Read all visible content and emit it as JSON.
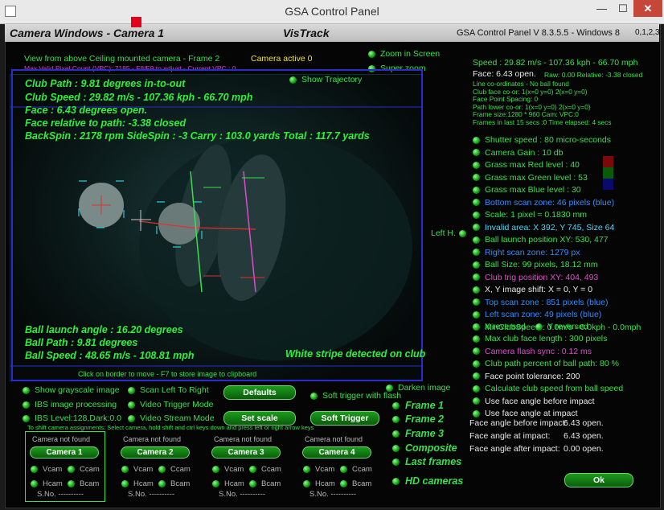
{
  "window": {
    "title": "GSA Control Panel",
    "min": "—",
    "max": "☐",
    "close": "✕"
  },
  "header": {
    "left": "Camera Windows - Camera  1",
    "center": "VisTrack",
    "version": "GSA Control Panel V 8.3.5.5 - Windows 8",
    "cams": "0,1,2,3"
  },
  "video": {
    "title": "View from above Ceiling mounted camera - Frame 2",
    "active": "Camera active 0",
    "vpc": "Max Valid Pixel Count (VPC): 7185 - F8/F9 to adjust - Current VPC : 0",
    "zoom_in": "Zoom in Screen",
    "super_zoom": "Super zoom",
    "show_traj": "Show Trajectory",
    "lines": [
      "Club Path : 9.81 degrees in-to-out",
      "Club Speed : 29.82 m/s - 107.36 kph - 66.70 mph",
      "Face : 6.43 degrees open.",
      "Face relative to path: -3.38 closed",
      "BackSpin : 2178 rpm  SideSpin : -3  Carry : 103.0 yards  Total : 117.7 yards"
    ],
    "bottom_lines": [
      "Ball launch angle : 16.20 degrees",
      "Ball Path : 9.81 degrees",
      "Ball Speed : 48.65 m/s - 108.81 mph"
    ],
    "stripe": "White stripe detected on club",
    "hint": "Click on border to move - F7 to store image to clipboard"
  },
  "right_info": {
    "speed": "Speed : 29.82 m/s - 107.36 kph - 66.70 mph",
    "face": "Face: 6.43 open.",
    "raw": "Raw: 0.00 Relative: -3.38 closed",
    "small": [
      "Line co-ordinates - No ball found",
      "Club face co-or: 1(x=0 y=0) 2(x=0 y=0)",
      "Face Point Spacing: 0",
      "Path lower co-or: 1(x=0 y=0) 2(x=0 y=0)",
      "Frame size:1280 * 960 Cam:  VPC:0",
      "Frames in last 15 secs :0 Time elapsed:   4 secs"
    ]
  },
  "settings": [
    {
      "label": "Shutter speed : 80 micro-seconds",
      "color": "#38e04b"
    },
    {
      "label": "Camera Gain : 10 db",
      "color": "#38e04b"
    },
    {
      "label": "Grass max Red level : 40",
      "color": "#38e04b"
    },
    {
      "label": "Grass max Green level : 53",
      "color": "#38e04b"
    },
    {
      "label": "Grass max Blue level : 30",
      "color": "#38e04b"
    },
    {
      "label": "Bottom scan zone: 46 pixels (blue)",
      "color": "#2f8cff"
    },
    {
      "label": "Scale: 1 pixel = 0.1830 mm",
      "color": "#38e04b"
    },
    {
      "label": "Invalid area: X 392, Y 745, Size 64",
      "color": "#4ad8ff"
    },
    {
      "label": "Ball launch position XY: 530, 477",
      "color": "#38e04b"
    },
    {
      "label": "Right scan zone: 1279 px",
      "color": "#2f8cff"
    },
    {
      "label": "Ball Size: 99 pixels, 18.12 mm",
      "color": "#38e04b"
    },
    {
      "label": "Club trig position XY: 404, 493",
      "color": "#e04ad0"
    },
    {
      "label": "X, Y image shift: X = 0, Y = 0",
      "color": "#e8e8e8"
    },
    {
      "label": "Top scan zone : 851 pixels (blue)",
      "color": "#2f8cff"
    },
    {
      "label": "Left scan zone: 49 pixels (blue)",
      "color": "#2f8cff"
    },
    {
      "label": "MinClubSpeed : 0.0m/s - 0.0kph - 0.0mph",
      "color": "#38e04b"
    }
  ],
  "left_h": "Left H.",
  "x_reversed": "X reversed",
  "y_reversed": "Y reversed",
  "settings2": [
    {
      "label": "Max club face length : 300 pixels",
      "color": "#38e04b"
    },
    {
      "label": "Camera flash sync :  0.12 ms",
      "color": "#e04ad0"
    },
    {
      "label": "Club path percent of ball path: 80 %",
      "color": "#38e04b"
    },
    {
      "label": "Face point tolerance: 200",
      "color": "#e8e8e8"
    },
    {
      "label": "Calculate club speed from ball speed",
      "color": "#38e04b"
    },
    {
      "label": "Use face angle before impact",
      "color": "#e8e8e8"
    },
    {
      "label": "Use face angle at impact",
      "color": "#e8e8e8"
    }
  ],
  "face_angles": {
    "before_label": "Face angle before impact:",
    "before_val": "6.43 open.",
    "at_label": "Face angle at impact:",
    "at_val": "6.43 open.",
    "after_label": "Face angle after impact:",
    "after_val": "0.00 open."
  },
  "ok": "Ok",
  "bottom": {
    "show_gray": "Show grayscale image",
    "ibs": "IBS image processing",
    "ibs_level": "IBS Level:128,Dark:0.0",
    "scan_lr": "Scan Left To Right",
    "video_trig": "Video Trigger Mode",
    "video_stream": "Video Stream Mode",
    "defaults": "Defaults",
    "set_scale": "Set scale",
    "soft_trig_flash": "Soft trigger with flash",
    "soft_trigger": "Soft Trigger",
    "darken": "Darken image",
    "assign_hint": "To shift camera assignments: Select camera, hold shift and ctrl keys down and press left or right arrow keys"
  },
  "frames": [
    "Frame 1",
    "Frame 2",
    "Frame 3",
    "Composite",
    "Last frames",
    "HD cameras"
  ],
  "cameras": [
    {
      "status": "Camera not found",
      "name": "Camera 1",
      "vcam": "Vcam",
      "ccam": "Ccam",
      "hcam": "Hcam",
      "bcam": "Bcam",
      "sno": "S.No. ----------"
    },
    {
      "status": "Camera not found",
      "name": "Camera 2",
      "vcam": "Vcam",
      "ccam": "Ccam",
      "hcam": "Hcam",
      "bcam": "Bcam",
      "sno": "S.No. ----------"
    },
    {
      "status": "Camera not found",
      "name": "Camera 3",
      "vcam": "Vcam",
      "ccam": "Ccam",
      "hcam": "Hcam",
      "bcam": "Bcam",
      "sno": "S.No. ----------"
    },
    {
      "status": "Camera not found",
      "name": "Camera 4",
      "vcam": "Vcam",
      "ccam": "Ccam",
      "hcam": "Hcam",
      "bcam": "Bcam",
      "sno": "S.No. ----------"
    }
  ]
}
